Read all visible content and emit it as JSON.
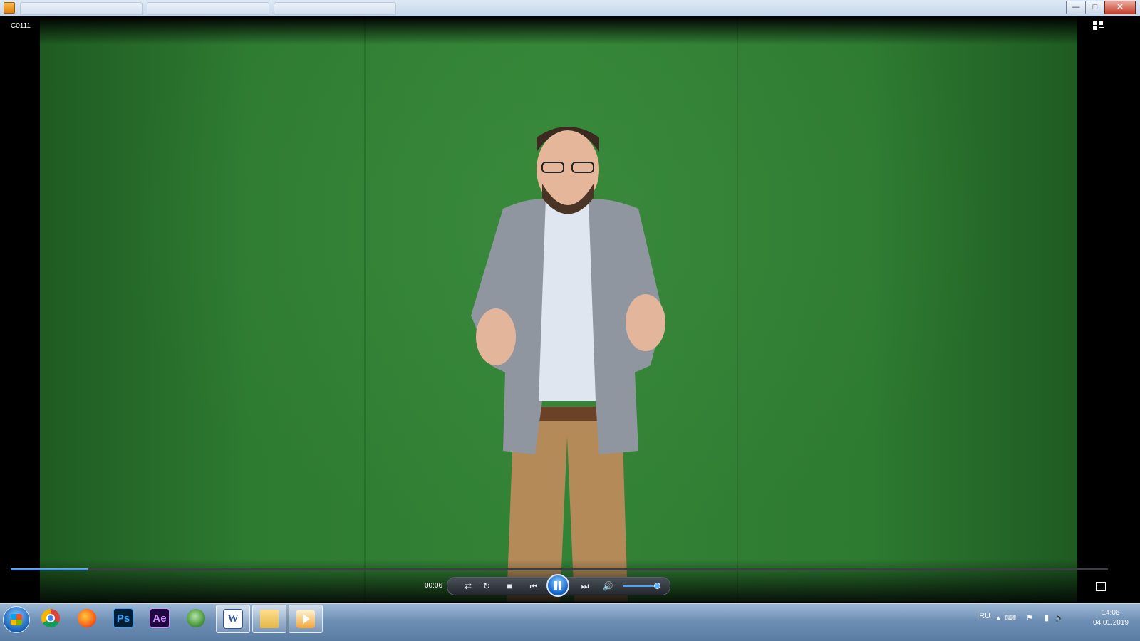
{
  "window": {
    "buttons": {
      "minimize": "—",
      "maximize": "□",
      "close": "✕"
    }
  },
  "player": {
    "clip_title": "C0111",
    "elapsed_time": "00:06",
    "progress_fraction": 0.07,
    "volume_fraction": 0.95,
    "icons": [
      "switch-to-library-icon",
      "shuffle-icon",
      "repeat-icon",
      "stop-icon",
      "previous-icon",
      "pause-icon",
      "next-icon",
      "volume-icon",
      "fullscreen-icon"
    ]
  },
  "taskbar": {
    "apps": [
      {
        "name": "chrome",
        "label": "",
        "active": false
      },
      {
        "name": "firefox",
        "label": "",
        "active": false
      },
      {
        "name": "photoshop",
        "label": "Ps",
        "active": false
      },
      {
        "name": "after-effects",
        "label": "Ae",
        "active": false
      },
      {
        "name": "globe-app",
        "label": "",
        "active": false
      },
      {
        "name": "word",
        "label": "W",
        "active": true
      },
      {
        "name": "file-explorer",
        "label": "",
        "active": true
      },
      {
        "name": "media-player",
        "label": "",
        "active": true
      }
    ],
    "tray": {
      "language": "RU",
      "time": "14:06",
      "date": "04.01.2019"
    }
  }
}
